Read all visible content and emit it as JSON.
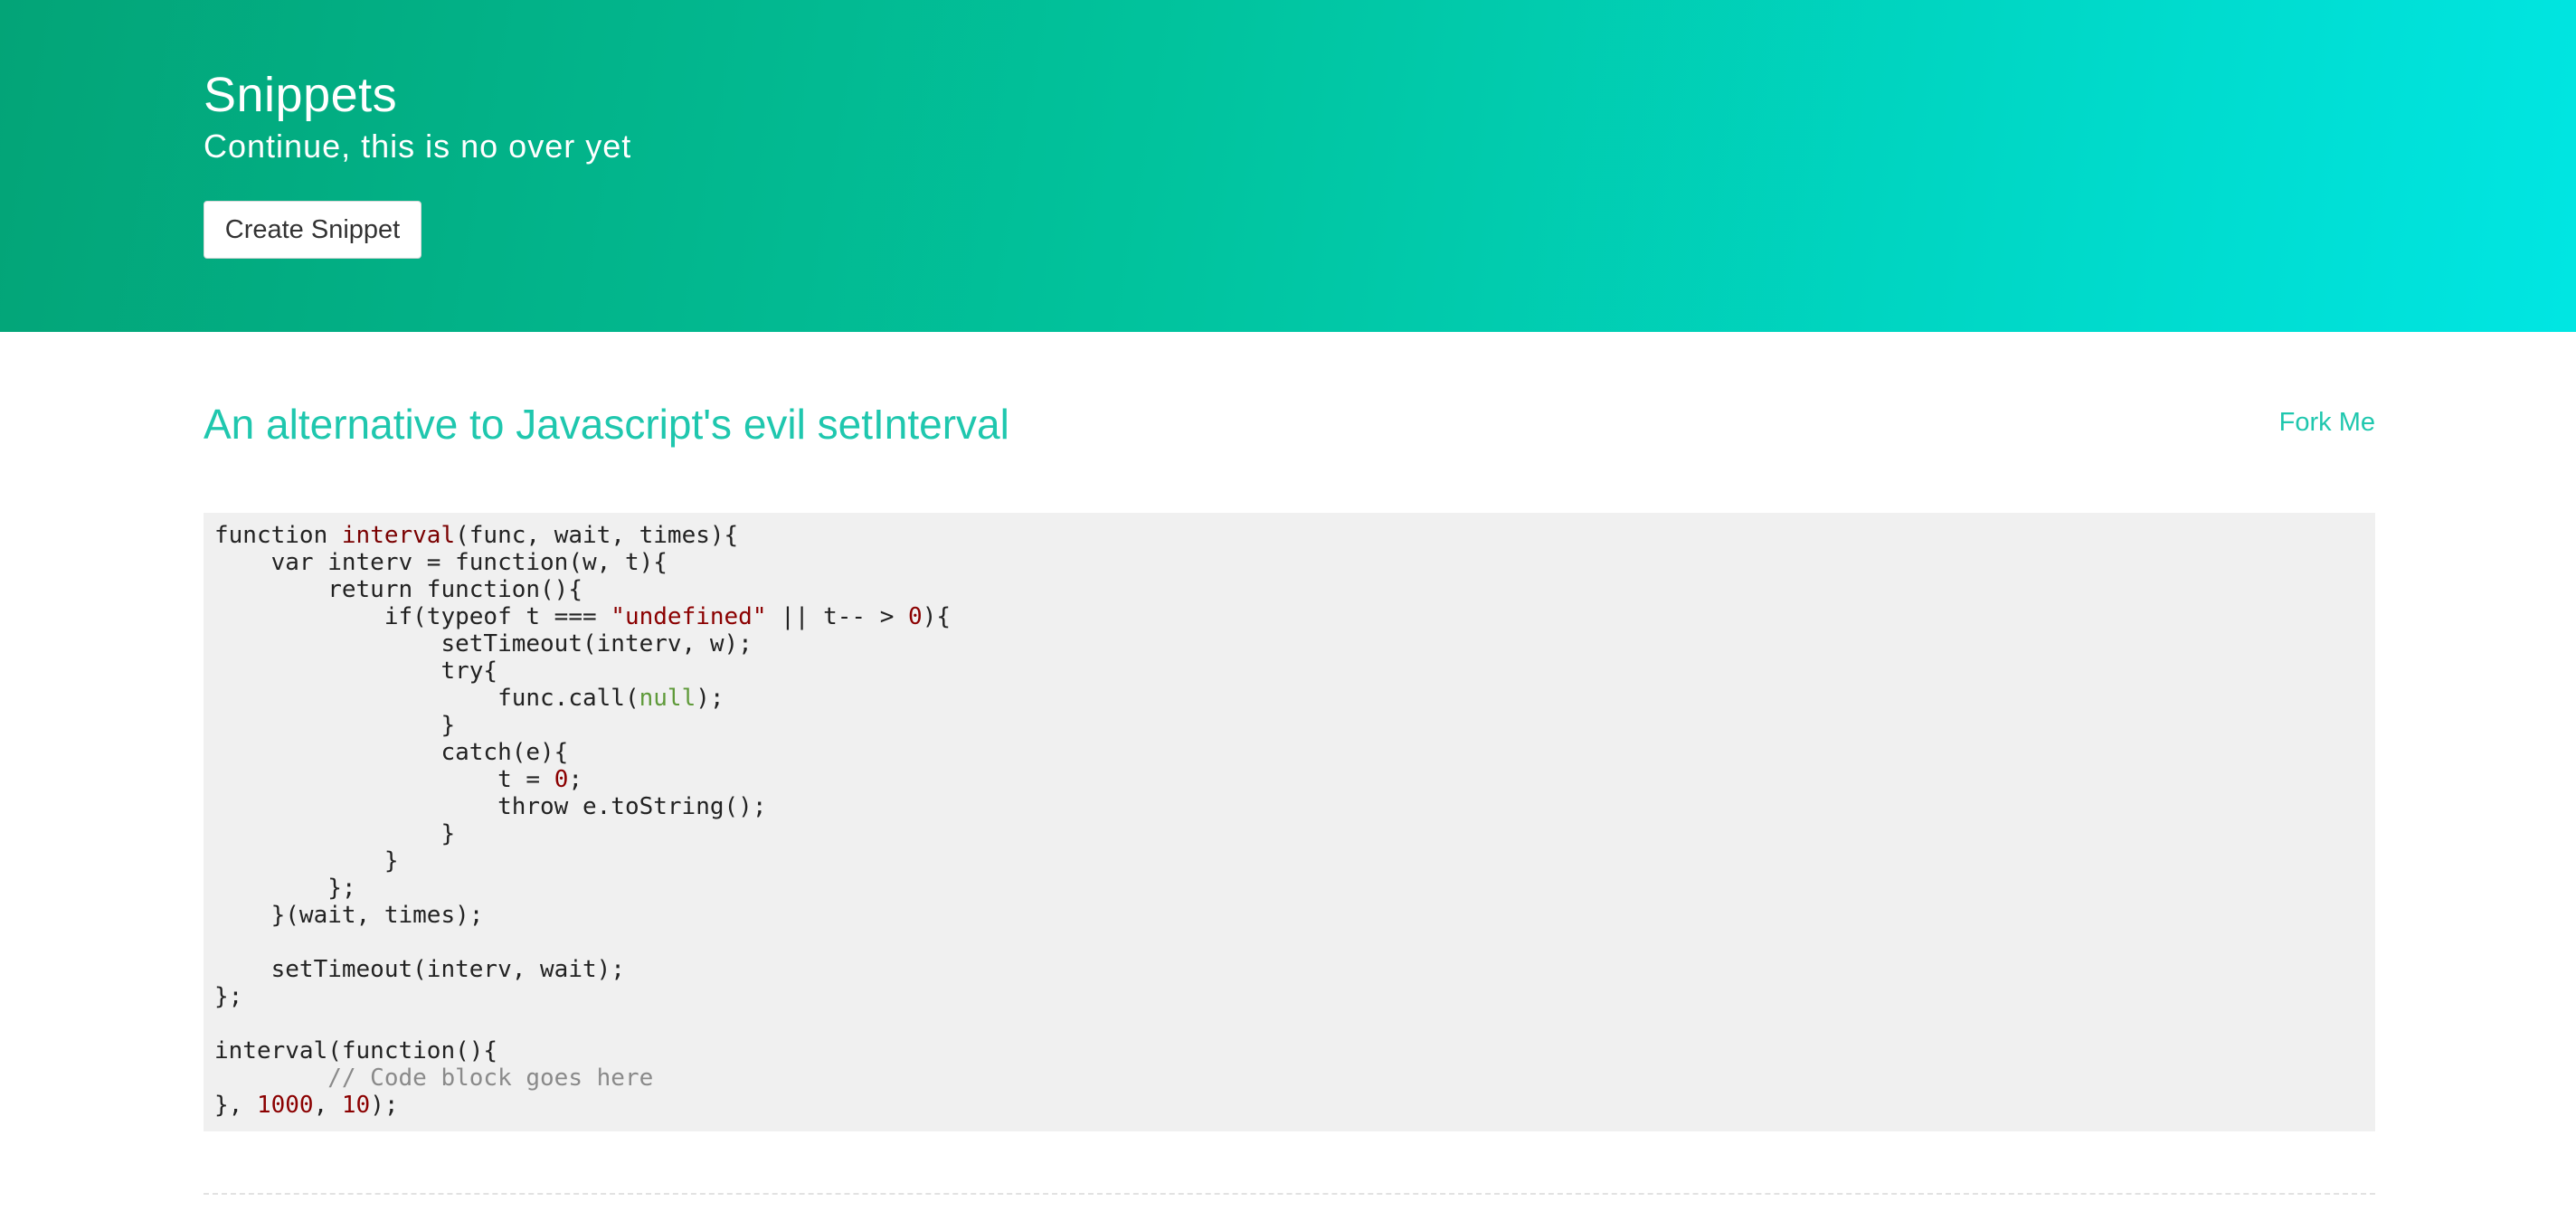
{
  "header": {
    "title": "Snippets",
    "subtitle": "Continue, this is no over yet",
    "create_button_label": "Create Snippet",
    "gradient_colors": [
      "#03a477",
      "#01c39d",
      "#00e6e3"
    ]
  },
  "snippet": {
    "title": "An alternative to Javascript's evil setInterval",
    "fork_label": "Fork Me",
    "accent_color": "#1fc7ae",
    "code_lines": [
      [
        {
          "t": "function "
        },
        {
          "t": "interval",
          "c": "fn"
        },
        {
          "t": "(func, wait, times){"
        }
      ],
      [
        {
          "t": "    var interv = function(w, t){"
        }
      ],
      [
        {
          "t": "        return function(){"
        }
      ],
      [
        {
          "t": "            if(typeof t === "
        },
        {
          "t": "\"undefined\"",
          "c": "str"
        },
        {
          "t": " || t-- > "
        },
        {
          "t": "0",
          "c": "num"
        },
        {
          "t": "){"
        }
      ],
      [
        {
          "t": "                setTimeout(interv, w);"
        }
      ],
      [
        {
          "t": "                try{"
        }
      ],
      [
        {
          "t": "                    func.call("
        },
        {
          "t": "null",
          "c": "null"
        },
        {
          "t": ");"
        }
      ],
      [
        {
          "t": "                }"
        }
      ],
      [
        {
          "t": "                catch(e){"
        }
      ],
      [
        {
          "t": "                    t = "
        },
        {
          "t": "0",
          "c": "num"
        },
        {
          "t": ";"
        }
      ],
      [
        {
          "t": "                    throw e.toString();"
        }
      ],
      [
        {
          "t": "                }"
        }
      ],
      [
        {
          "t": "            }"
        }
      ],
      [
        {
          "t": "        };"
        }
      ],
      [
        {
          "t": "    }(wait, times);"
        }
      ],
      [
        {
          "t": ""
        }
      ],
      [
        {
          "t": "    setTimeout(interv, wait);"
        }
      ],
      [
        {
          "t": "};"
        }
      ],
      [
        {
          "t": ""
        }
      ],
      [
        {
          "t": "interval(function(){"
        }
      ],
      [
        {
          "t": "        // Code block goes here",
          "c": "comment"
        }
      ],
      [
        {
          "t": "}, "
        },
        {
          "t": "1000",
          "c": "num"
        },
        {
          "t": ", "
        },
        {
          "t": "10",
          "c": "num"
        },
        {
          "t": ");"
        }
      ]
    ]
  }
}
